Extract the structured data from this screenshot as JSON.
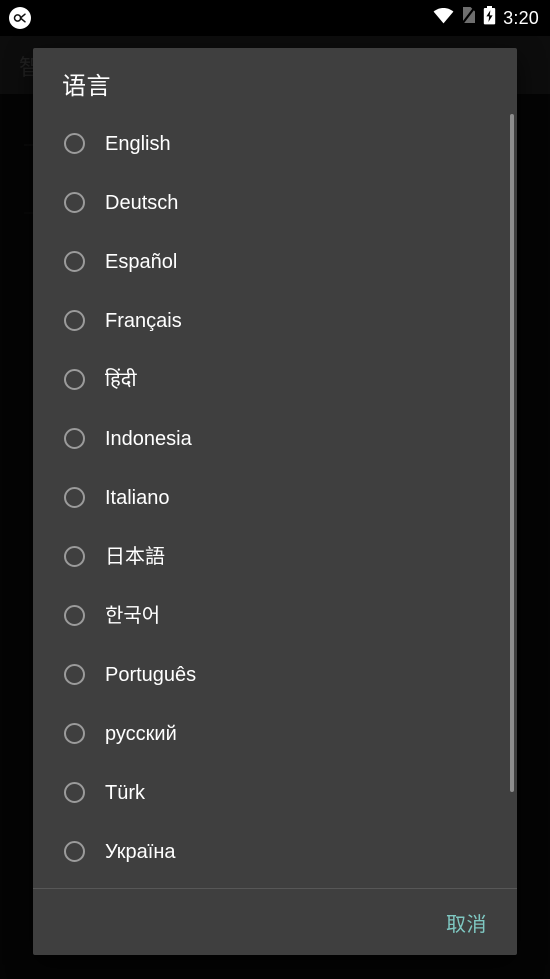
{
  "status_bar": {
    "app_icon": "app-badge-icon",
    "wifi_icon": "wifi-icon",
    "sim_icon": "no-sim-icon",
    "battery_icon": "battery-charging-icon",
    "clock": "3:20"
  },
  "background": {
    "toolbar_title": "智"
  },
  "dialog": {
    "title": "语言",
    "options": [
      {
        "label": "English",
        "selected": false
      },
      {
        "label": "Deutsch",
        "selected": false
      },
      {
        "label": "Español",
        "selected": false
      },
      {
        "label": "Français",
        "selected": false
      },
      {
        "label": "हिंदी",
        "selected": false
      },
      {
        "label": "Indonesia",
        "selected": false
      },
      {
        "label": "Italiano",
        "selected": false
      },
      {
        "label": "日本語",
        "selected": false
      },
      {
        "label": "한국어",
        "selected": false
      },
      {
        "label": "Português",
        "selected": false
      },
      {
        "label": "русский",
        "selected": false
      },
      {
        "label": "Türk",
        "selected": false
      },
      {
        "label": "Україна",
        "selected": false
      }
    ],
    "cancel_label": "取消"
  },
  "colors": {
    "dialog_bg": "#3f3f3f",
    "accent": "#7fc8c2",
    "radio_outline": "#9b9b9b",
    "text": "#ffffff",
    "divider": "#575757",
    "scrollbar": "#8e8e8e",
    "status_bg": "#000000"
  }
}
